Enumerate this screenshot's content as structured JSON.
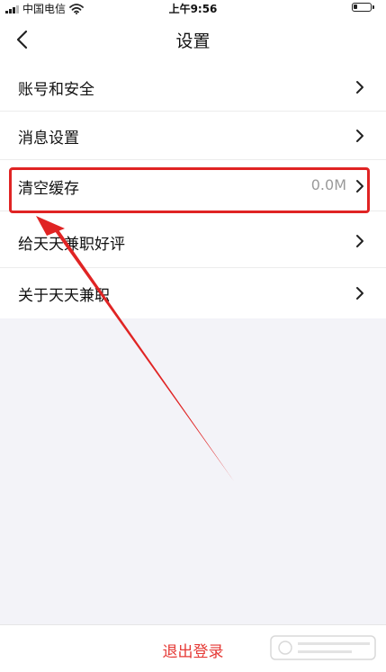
{
  "status_bar": {
    "carrier": "中国电信",
    "time": "上午9:56"
  },
  "nav": {
    "title": "设置",
    "back_icon": "chevron-left-icon"
  },
  "menu": {
    "items": [
      {
        "label": "账号和安全",
        "value": ""
      },
      {
        "label": "消息设置",
        "value": ""
      },
      {
        "label": "清空缓存",
        "value": "0.0M"
      },
      {
        "label": "给天天兼职好评",
        "value": ""
      },
      {
        "label": "关于天天兼职",
        "value": ""
      }
    ]
  },
  "logout": {
    "label": "退出登录"
  },
  "colors": {
    "accent_red": "#e53935",
    "annotation_red": "#e02424",
    "page_background": "#f3f3f8",
    "value_gray": "#9a9a9a"
  }
}
